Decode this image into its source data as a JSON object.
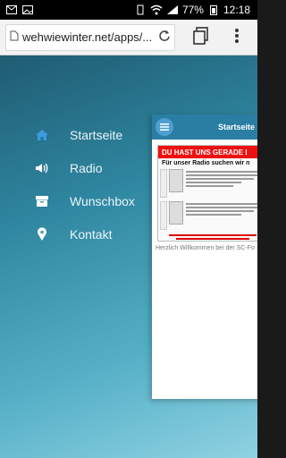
{
  "status_bar": {
    "battery_percent": "77%",
    "time": "12:18"
  },
  "browser": {
    "url": "wehwiewinter.net/apps/...",
    "icons": [
      "page-icon",
      "refresh-icon",
      "tabs-icon",
      "overflow-menu-icon"
    ]
  },
  "nav": {
    "items": [
      {
        "label": "Startseite",
        "icon": "home-icon"
      },
      {
        "label": "Radio",
        "icon": "speaker-icon"
      },
      {
        "label": "Wunschbox",
        "icon": "box-icon"
      },
      {
        "label": "Kontakt",
        "icon": "location-pin-icon"
      }
    ]
  },
  "preview": {
    "header_title": "Startseite",
    "banner_title": "DU HAST UNS GERADE I",
    "banner_subtitle": "Für unser Radio suchen wir n",
    "welcome_text": "Herzlich Willkommen bei der SC-Fo"
  },
  "colors": {
    "accent": "#2a7ea3",
    "banner_red": "#e11111"
  }
}
